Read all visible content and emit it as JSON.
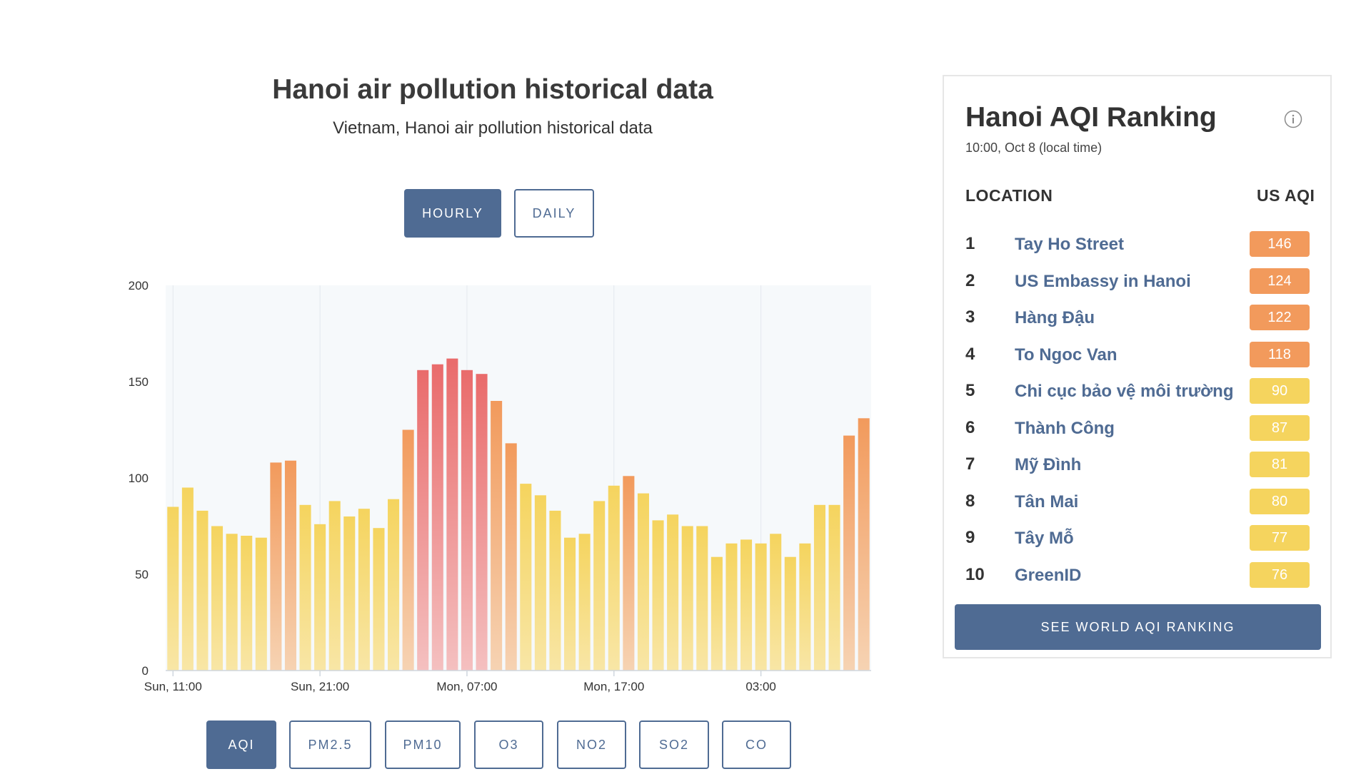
{
  "header": {
    "title": "Hanoi air pollution historical data",
    "subtitle": "Vietnam, Hanoi air pollution historical data"
  },
  "range_buttons": {
    "hourly": "HOURLY",
    "daily": "DAILY"
  },
  "pollutant_buttons": [
    "AQI",
    "PM2.5",
    "PM10",
    "O3",
    "NO2",
    "SO2",
    "CO"
  ],
  "chart_data": {
    "type": "bar",
    "x_tick_labels": [
      "Sun, 11:00",
      "Sun, 21:00",
      "Mon, 07:00",
      "Mon, 17:00",
      "03:00"
    ],
    "y_ticks": [
      0,
      50,
      100,
      150,
      200
    ],
    "ylim": [
      0,
      200
    ],
    "grid": true,
    "values": [
      85,
      95,
      83,
      75,
      71,
      70,
      69,
      108,
      109,
      86,
      76,
      88,
      80,
      84,
      74,
      89,
      125,
      156,
      159,
      162,
      156,
      154,
      140,
      118,
      97,
      91,
      83,
      69,
      71,
      88,
      96,
      101,
      92,
      78,
      81,
      75,
      75,
      59,
      66,
      68,
      66,
      71,
      59,
      66,
      86,
      86,
      122,
      131
    ]
  },
  "ranking": {
    "title": "Hanoi AQI Ranking",
    "time": "10:00, Oct 8 (local time)",
    "col_location": "LOCATION",
    "col_aqi": "US AQI",
    "rows": [
      {
        "rank": "1",
        "location": "Tay Ho Street",
        "aqi": "146"
      },
      {
        "rank": "2",
        "location": "US Embassy in Hanoi",
        "aqi": "124"
      },
      {
        "rank": "3",
        "location": "Hàng Đậu",
        "aqi": "122"
      },
      {
        "rank": "4",
        "location": "To Ngoc Van",
        "aqi": "118"
      },
      {
        "rank": "5",
        "location": "Chi cục bảo vệ môi trường",
        "aqi": "90"
      },
      {
        "rank": "6",
        "location": "Thành Công",
        "aqi": "87"
      },
      {
        "rank": "7",
        "location": "Mỹ Đình",
        "aqi": "81"
      },
      {
        "rank": "8",
        "location": "Tân Mai",
        "aqi": "80"
      },
      {
        "rank": "9",
        "location": "Tây Mỗ",
        "aqi": "77"
      },
      {
        "rank": "10",
        "location": "GreenID",
        "aqi": "76"
      }
    ],
    "see_button": "SEE WORLD AQI RANKING"
  },
  "colors": {
    "accent": "#4f6b93",
    "aqi_moderate": "#f5d45e",
    "aqi_sensitive": "#f29a5c",
    "aqi_unhealthy": "#e96b6b"
  },
  "icons": {
    "info": "info-icon"
  }
}
